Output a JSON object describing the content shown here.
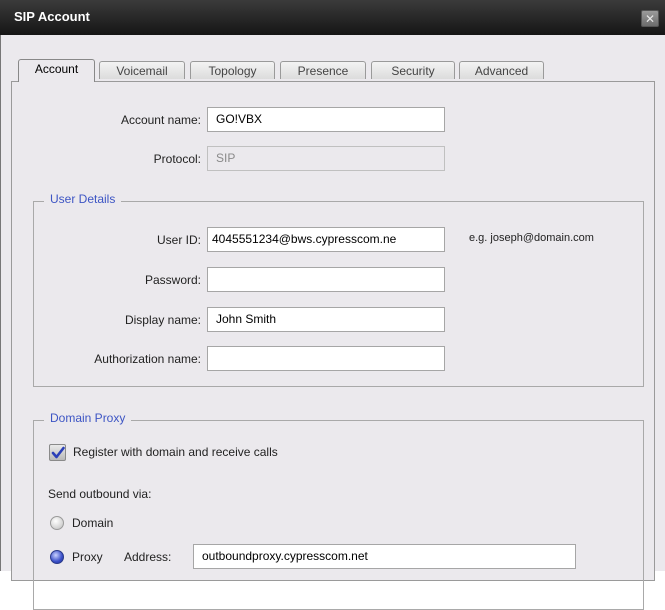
{
  "window": {
    "title": "SIP Account",
    "close_glyph": "✕"
  },
  "tabs": [
    {
      "label": "Account",
      "active": true
    },
    {
      "label": "Voicemail"
    },
    {
      "label": "Topology"
    },
    {
      "label": "Presence"
    },
    {
      "label": "Security"
    },
    {
      "label": "Advanced"
    }
  ],
  "account": {
    "account_name_label": "Account name:",
    "account_name_value": "GO!VBX",
    "protocol_label": "Protocol:",
    "protocol_value": "SIP"
  },
  "user_details": {
    "legend": "User Details",
    "user_id_label": "User ID:",
    "user_id_value": "4045551234@bws.cypresscom.ne",
    "user_id_hint": "e.g. joseph@domain.com",
    "password_label": "Password:",
    "password_value": "",
    "display_name_label": "Display name:",
    "display_name_value": "John Smith",
    "authorization_name_label": "Authorization name:",
    "authorization_name_value": ""
  },
  "domain_proxy": {
    "legend": "Domain Proxy",
    "register_label": "Register with domain and receive calls",
    "register_checked": true,
    "send_outbound_label": "Send outbound via:",
    "domain_option": "Domain",
    "proxy_option": "Proxy",
    "selected": "Proxy",
    "address_label": "Address:",
    "address_value": "outboundproxy.cypresscom.net"
  }
}
